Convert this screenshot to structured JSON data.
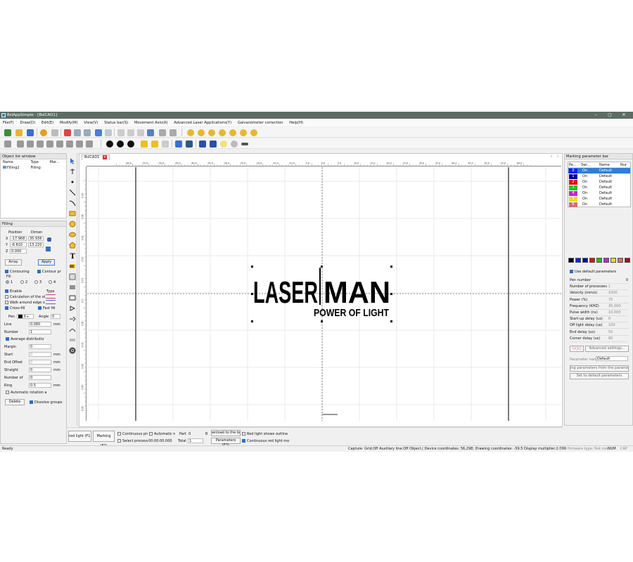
{
  "window": {
    "title": "BslAppSimple - [BslCAD1]",
    "min": "–",
    "max": "▢",
    "close": "✕"
  },
  "menu": [
    "File(F)",
    "Draw(D)",
    "Edit(E)",
    "Modify(M)",
    "View(V)",
    "Status bar(S)",
    "Movement Axis(A)",
    "Advanced Laser Applications(Y)",
    "Galvanometer correction",
    "Help(H)"
  ],
  "object_list": {
    "title": "Object list window",
    "columns": [
      "Name",
      "Type",
      "Mar..."
    ],
    "rows": [
      {
        "name": "Filling2",
        "type": "Filling"
      }
    ]
  },
  "filling": {
    "title": "Filling",
    "pos_header": "Position",
    "dim_header": "Dimen",
    "x_label": "X",
    "x_pos": "-17.968",
    "x_dim": "35.936",
    "y_label": "Y",
    "y_pos": "-6.610",
    "y_dim": "13.220",
    "z_label": "Z",
    "z_pos": "0.000",
    "array_btn": "Array",
    "apply_btn": "Apply",
    "contouring": "Contouring",
    "contour_pri": "Contour pri",
    "fill_label": "Fill",
    "radio": [
      "1",
      "2",
      "3",
      "4"
    ],
    "enable": "Enable",
    "type_label": "Type",
    "calc": "Calculation of the obj",
    "walk": "Walk around edge or",
    "crossfill": "Cross-fill",
    "fastfill": "Fast fill",
    "pen_label": "Pen",
    "pen_value": "0",
    "angle_label": "Angle",
    "angle_value": "0",
    "line_label": "Line",
    "line_value": "0.060",
    "mm1": "mm",
    "number_label": "Number",
    "number_value": "1",
    "avg": "Average distributio",
    "margin_label": "Margin",
    "margin_value": "0",
    "start_label": "Start",
    "start_value": "0",
    "mm2": "mm",
    "endoffset_label": "End Offset",
    "endoffset_value": "0",
    "mm3": "mm",
    "straight_label": "Straight",
    "straight_value": "0",
    "mm4": "mm",
    "numberof_label": "Number of",
    "numberof_value": "0",
    "ring_label": "Ring",
    "ring_value": "0.5",
    "mm5": "mm",
    "autorot": "Automatic rotation a",
    "delete_btn": "Delete",
    "dissolve": "Dissolve groups"
  },
  "canvas": {
    "tab": "BslCAD1",
    "ruler_labels": [
      "-60.0",
      "-55.0",
      "-50.0",
      "-45.0",
      "-40.0",
      "-35.0",
      "-30.0",
      "-25.0",
      "-20.0",
      "-15.0",
      "-10.0",
      "-5.0",
      "0.0",
      "5.0",
      "10.0",
      "15.0",
      "20.0",
      "25.0",
      "30.0",
      "35.0",
      "40.0",
      "45.0",
      "50.0",
      "55.0",
      "60.0"
    ],
    "vruler_labels": [
      "50.0",
      "40.0",
      "30.0",
      "20.0",
      "10.0",
      "0.0",
      "-10.0",
      "-20.0",
      "-30.0",
      "-40.0",
      "-50.0"
    ],
    "logo_main_left": "LASER",
    "logo_main_right": "MAN",
    "logo_sub": "POWER OF LIGHT"
  },
  "marking_params": {
    "title": "Marking parameter bar",
    "columns": [
      "Pe...",
      "Swi...",
      "Name",
      "Nur"
    ],
    "pens": [
      {
        "num": "0",
        "sw": "On",
        "name": "Default",
        "color": "#1a1aff"
      },
      {
        "num": "1",
        "sw": "On",
        "name": "Default",
        "color": "#0000a0"
      },
      {
        "num": "2",
        "sw": "On",
        "name": "Default",
        "color": "#e01010"
      },
      {
        "num": "3",
        "sw": "On",
        "name": "Default",
        "color": "#20c020"
      },
      {
        "num": "4",
        "sw": "On",
        "name": "Default",
        "color": "#d020d0"
      },
      {
        "num": "5",
        "sw": "On",
        "name": "Default",
        "color": "#e0e020"
      },
      {
        "num": "6",
        "sw": "On",
        "name": "Default",
        "color": "#d07070"
      }
    ],
    "swatches": [
      "#000000",
      "#1a1aff",
      "#0000a0",
      "#e01010",
      "#20c020",
      "#d020d0",
      "#e0e020",
      "#d07070",
      "#a01020"
    ],
    "use_default": "Use default parameters",
    "params": [
      {
        "label": "Pen number",
        "value": "0"
      },
      {
        "label": "Number of processes",
        "value": "1"
      },
      {
        "label": "Velocity (mm/s)",
        "value": "1000"
      },
      {
        "label": "Power (%)",
        "value": "75"
      },
      {
        "label": "Frequency (KHZ)",
        "value": "30.000"
      },
      {
        "label": "Pulse width (ns)",
        "value": "10.000"
      },
      {
        "label": "Start-up delay (us)",
        "value": "0"
      },
      {
        "label": "Off light delay (us)",
        "value": "100"
      },
      {
        "label": "End delay (us)",
        "value": "50"
      },
      {
        "label": "Corner delay (us)",
        "value": "80"
      }
    ],
    "advanced_btn": "Advanced settings...",
    "param_name_label": "Parameter name",
    "param_name_value": "Default",
    "get_params": "ing parameters from the parameter li",
    "set_default": "Set to default parameters"
  },
  "bottom": {
    "red_light": "red light (F1)",
    "marking": "Marking (F2)",
    "continuous": "Continuous proc",
    "automatic": "Automatic rec",
    "select_proc": "Select processin",
    "time": "00:00:00.000",
    "part_label": "Part",
    "part_value": "0",
    "r_label": "R",
    "total_label": "Total",
    "total_value": "1",
    "download": "wnload to the boa",
    "parameters": "Parameters (F3)",
    "red_outline": "Red light shows outline",
    "continuous_red": "Continuous red light mo"
  },
  "status": {
    "ready": "Ready",
    "info": "Capture: Grid.Off Auxiliary line.Off Object.(  Device coordinates: 56,298; Drawing coordinates: -59.5  Display multiplier:2.000",
    "usb": "USB firmware type: Not con",
    "num": "NUM",
    "cap": "CAP"
  }
}
